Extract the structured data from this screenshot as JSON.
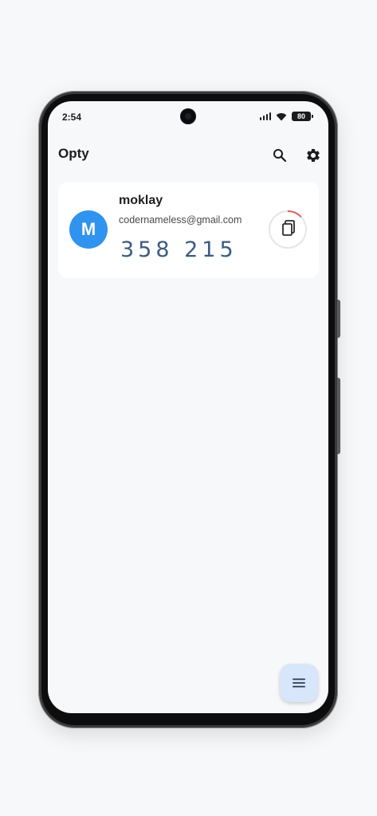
{
  "status_bar": {
    "time": "2:54",
    "battery": "80",
    "icons": [
      "signal-icon",
      "wifi-icon",
      "battery-icon"
    ]
  },
  "app_bar": {
    "title": "Opty",
    "actions": [
      "search-icon",
      "settings-icon"
    ]
  },
  "accounts": [
    {
      "avatar_letter": "M",
      "avatar_color": "#2f93ef",
      "name": "moklay",
      "email": "codernameless@gmail.com",
      "code": "358 215",
      "code_color": "#3b5b82",
      "timer_remaining_fraction": 0.13,
      "timer_color": "#e06060",
      "copy_icon": "copy-icon"
    }
  ],
  "fab": {
    "icon": "menu-icon",
    "color": "#d7e6fb"
  }
}
